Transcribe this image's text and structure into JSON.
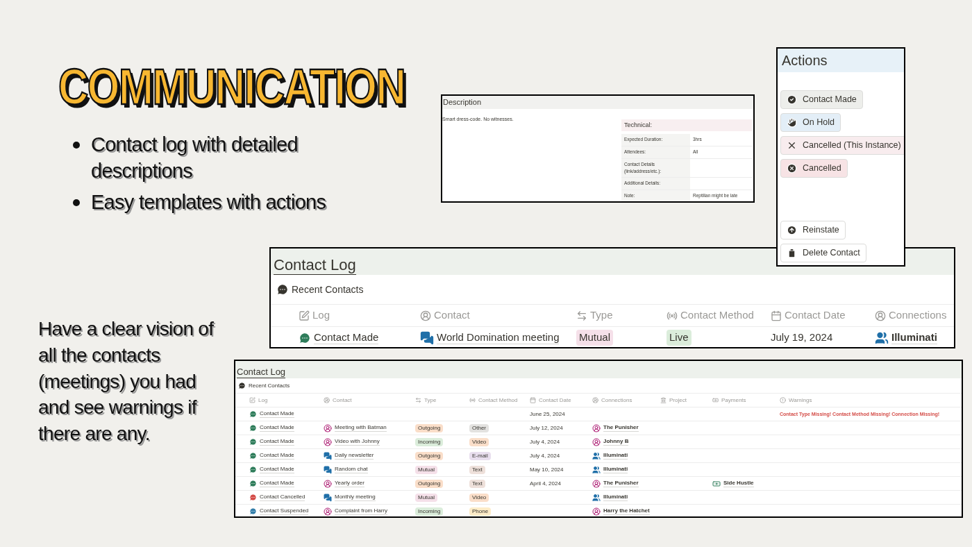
{
  "slide": {
    "title": "COMMUNICATION",
    "bullets": [
      "Contact log with detailed descriptions",
      "Easy templates with actions"
    ],
    "note": "Have a clear vision of all the contacts (meetings) you had and see warnings if there are any."
  },
  "description_panel": {
    "heading": "Description",
    "text": "Smart dress-code. No witnesses.",
    "technical": {
      "heading": "Technical:",
      "rows": [
        {
          "label": "Expected Duration:",
          "value": "3hrs"
        },
        {
          "label": "Attendees:",
          "value": "All"
        },
        {
          "label": "Contact Details (link/address/etc.):"
        },
        {
          "label": "Additional Details:"
        },
        {
          "label": "Note:",
          "value": "Reptilian might be late"
        }
      ]
    }
  },
  "actions_panel": {
    "heading": "Actions",
    "buttons": [
      {
        "label": "Contact Made",
        "kind": "check",
        "color": "#edeeeb"
      },
      {
        "label": "On Hold",
        "kind": "hold",
        "color": "#e3eef7"
      },
      {
        "label": "Cancelled (This Instance)",
        "kind": "cross",
        "color": "#f8ecee"
      },
      {
        "label": "Cancelled",
        "kind": "cancel",
        "color": "#f7e3e5"
      },
      {
        "label": "Reinstate",
        "kind": "reinstate",
        "color": "#ffffff"
      },
      {
        "label": "Delete Contact",
        "kind": "delete",
        "color": "#ffffff"
      }
    ]
  },
  "contact_log_large": {
    "title": "Contact Log",
    "section": "Recent Contacts",
    "columns": [
      "Log",
      "Contact",
      "Type",
      "Contact Method",
      "Contact Date",
      "Connections"
    ],
    "rows": [
      {
        "log": {
          "label": "Contact Made",
          "kind": "made"
        },
        "contact": {
          "label": "World Domination meeting",
          "kind": "group"
        },
        "type": {
          "label": "Mutual",
          "color": "#f5e0e9"
        },
        "method": {
          "label": "Live",
          "color": "#dbeddb"
        },
        "date": "July 19, 2024",
        "connection": {
          "label": "Illuminati",
          "kind": "group"
        }
      }
    ]
  },
  "contact_log_small": {
    "title": "Contact Log",
    "section": "Recent Contacts",
    "columns": [
      "Log",
      "Contact",
      "Type",
      "Contact Method",
      "Contact Date",
      "Connections",
      "Project",
      "Payments",
      "Warnings"
    ],
    "rows": [
      {
        "log": {
          "label": "Contact Made",
          "kind": "made"
        },
        "date": "June 25, 2024",
        "warning": "Contact Type Missing! Contact Method Missing! Connection Missing!"
      },
      {
        "log": {
          "label": "Contact Made",
          "kind": "made"
        },
        "contact": {
          "label": "Meeting with Batman",
          "kind": "person"
        },
        "type": {
          "label": "Outgoing",
          "color": "#fadec9"
        },
        "method": {
          "label": "Other",
          "color": "#e3e2e0"
        },
        "date": "July 12, 2024",
        "connection": {
          "label": "The Punisher",
          "kind": "person"
        }
      },
      {
        "log": {
          "label": "Contact Made",
          "kind": "made"
        },
        "contact": {
          "label": "Video with Johnny",
          "kind": "person"
        },
        "type": {
          "label": "Incoming",
          "color": "#dbeddb"
        },
        "method": {
          "label": "Video",
          "color": "#fadec9"
        },
        "date": "July 4, 2024",
        "connection": {
          "label": "Johnny B",
          "kind": "person"
        }
      },
      {
        "log": {
          "label": "Contact Made",
          "kind": "made"
        },
        "contact": {
          "label": "Daily newsletter",
          "kind": "group"
        },
        "type": {
          "label": "Outgoing",
          "color": "#fadec9"
        },
        "method": {
          "label": "E-mail",
          "color": "#e8deee"
        },
        "date": "July 4, 2024",
        "connection": {
          "label": "Illuminati",
          "kind": "group"
        }
      },
      {
        "log": {
          "label": "Contact Made",
          "kind": "made"
        },
        "contact": {
          "label": "Random chat",
          "kind": "group"
        },
        "type": {
          "label": "Mutual",
          "color": "#f5e0e9"
        },
        "method": {
          "label": "Text",
          "color": "#eee0da"
        },
        "date": "May 10, 2024",
        "connection": {
          "label": "Illuminati",
          "kind": "group"
        }
      },
      {
        "log": {
          "label": "Contact Made",
          "kind": "made"
        },
        "contact": {
          "label": "Yearly order",
          "kind": "person"
        },
        "type": {
          "label": "Outgoing",
          "color": "#fadec9"
        },
        "method": {
          "label": "Text",
          "color": "#eee0da"
        },
        "date": "April 4, 2024",
        "connection": {
          "label": "The Punisher",
          "kind": "person"
        },
        "payment": "Side Hustle"
      },
      {
        "log": {
          "label": "Contact Cancelled",
          "kind": "cancelled"
        },
        "contact": {
          "label": "Monthly meeting",
          "kind": "group"
        },
        "type": {
          "label": "Mutual",
          "color": "#f5e0e9"
        },
        "method": {
          "label": "Video",
          "color": "#fadec9"
        },
        "connection": {
          "label": "Illuminati",
          "kind": "group"
        }
      },
      {
        "log": {
          "label": "Contact Suspended",
          "kind": "suspended"
        },
        "contact": {
          "label": "Complaint from Harry",
          "kind": "person"
        },
        "type": {
          "label": "Incoming",
          "color": "#dbeddb"
        },
        "method": {
          "label": "Phone",
          "color": "#fdecc8"
        },
        "connection": {
          "label": "Harry the Hatchet",
          "kind": "person"
        }
      }
    ]
  }
}
